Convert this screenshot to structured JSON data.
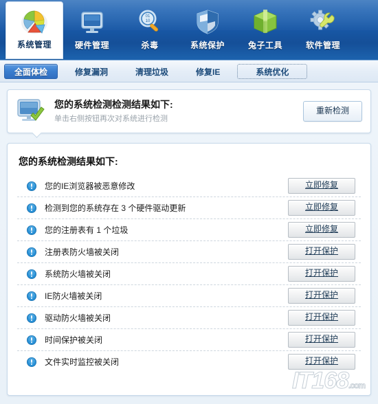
{
  "toolbar": {
    "items": [
      {
        "label": "系统管理",
        "icon": "pie-chart-icon",
        "active": true
      },
      {
        "label": "硬件管理",
        "icon": "monitor-icon",
        "active": false
      },
      {
        "label": "杀毒",
        "icon": "magnifier-icon",
        "active": false
      },
      {
        "label": "系统保护",
        "icon": "shield-icon",
        "active": false
      },
      {
        "label": "兔子工具",
        "icon": "green-box-icon",
        "active": false
      },
      {
        "label": "软件管理",
        "icon": "gear-wrench-icon",
        "active": false
      }
    ]
  },
  "tabs": [
    {
      "label": "全面体检",
      "state": "active"
    },
    {
      "label": "修复漏洞",
      "state": "normal"
    },
    {
      "label": "清理垃圾",
      "state": "normal"
    },
    {
      "label": "修复IE",
      "state": "normal"
    },
    {
      "label": "系统优化",
      "state": "focused"
    }
  ],
  "header_card": {
    "icon": "monitor-check-icon",
    "title": "您的系统检测检测结果如下:",
    "subtitle": "单击右侧按钮再次对系统进行检测",
    "rescan_button": "重新检测"
  },
  "results": {
    "title": "您的系统检测结果如下:",
    "rows": [
      {
        "icon": "warning-icon",
        "text": "您的IE浏览器被恶意修改",
        "action": "立即修复"
      },
      {
        "icon": "warning-icon",
        "text": "检测到您的系统存在 3 个硬件驱动更新",
        "action": "立即修复"
      },
      {
        "icon": "warning-icon",
        "text": "您的注册表有 1 个垃圾",
        "action": "立即修复"
      },
      {
        "icon": "warning-icon",
        "text": "注册表防火墙被关闭",
        "action": "打开保护"
      },
      {
        "icon": "warning-icon",
        "text": "系统防火墙被关闭",
        "action": "打开保护"
      },
      {
        "icon": "warning-icon",
        "text": "IE防火墙被关闭",
        "action": "打开保护"
      },
      {
        "icon": "warning-icon",
        "text": "驱动防火墙被关闭",
        "action": "打开保护"
      },
      {
        "icon": "warning-icon",
        "text": "时间保护被关闭",
        "action": "打开保护"
      },
      {
        "icon": "warning-icon",
        "text": "文件实时监控被关闭",
        "action": "打开保护"
      }
    ]
  },
  "watermark": {
    "text": "IT168",
    "suffix": ".com"
  },
  "colors": {
    "toolbar_blue": "#1858a6",
    "tab_active_blue": "#3b7fd0",
    "warning_blue": "#1f8ad6",
    "panel_white": "#ffffff",
    "content_bg": "#eef4fa"
  }
}
